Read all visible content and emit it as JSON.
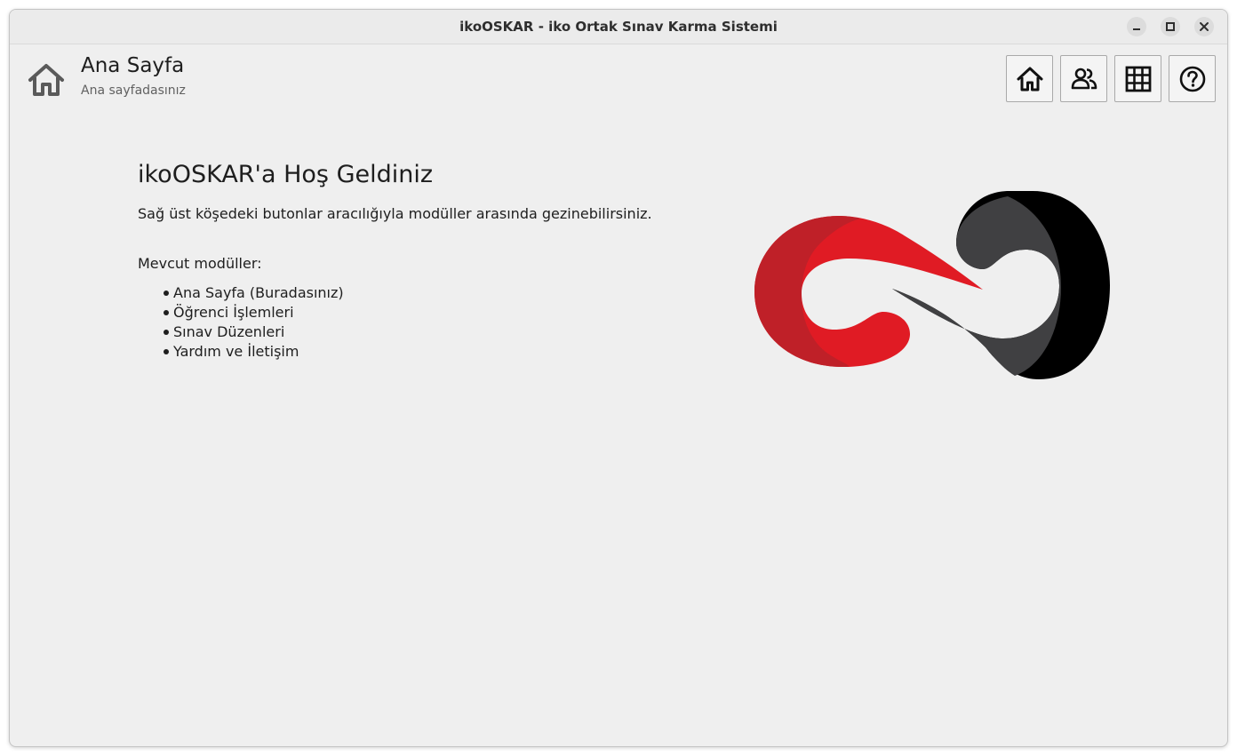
{
  "window": {
    "title": "ikoOSKAR - iko Ortak Sınav Karma Sistemi"
  },
  "header": {
    "title": "Ana Sayfa",
    "subtitle": "Ana sayfadasınız",
    "icon": "home-icon"
  },
  "nav": {
    "buttons": [
      {
        "icon": "home-icon"
      },
      {
        "icon": "users-icon"
      },
      {
        "icon": "table-icon"
      },
      {
        "icon": "help-icon"
      }
    ]
  },
  "main": {
    "welcome_title": "ikoOSKAR'a Hoş Geldiniz",
    "welcome_desc": "Sağ üst köşedeki butonlar aracılığıyla modüller arasında gezinebilirsiniz.",
    "modules_heading": "Mevcut modüller:",
    "modules": [
      "Ana Sayfa (Buradasınız)",
      "Öğrenci İşlemleri",
      "Sınav Düzenleri",
      "Yardım ve İletişim"
    ]
  },
  "colors": {
    "logo_red": "#e01b24",
    "logo_dark_red": "#bf2028",
    "logo_grey": "#404042",
    "logo_black": "#000000"
  }
}
